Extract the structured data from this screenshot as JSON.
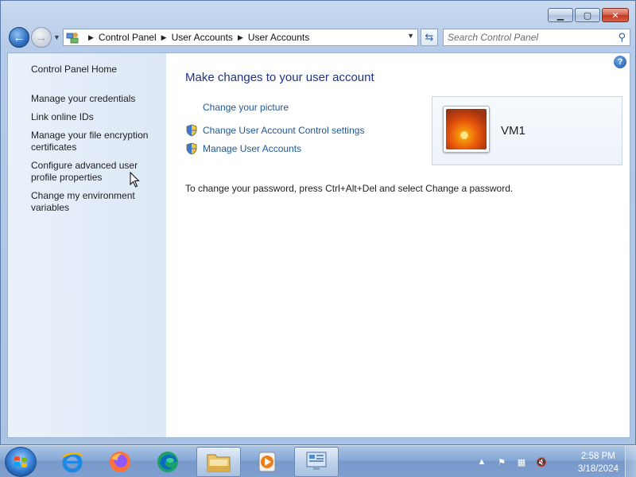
{
  "window": {
    "minimize_icon": "minimize-icon",
    "maximize_icon": "maximize-icon",
    "close_icon": "close-icon"
  },
  "navbar": {
    "breadcrumb": [
      "Control Panel",
      "User Accounts",
      "User Accounts"
    ],
    "search_placeholder": "Search Control Panel"
  },
  "sidebar": {
    "items": [
      "Control Panel Home",
      "Manage your credentials",
      "Link online IDs",
      "Manage your file encryption certificates",
      "Configure advanced user profile properties",
      "Change my environment variables"
    ]
  },
  "main": {
    "title": "Make changes to your user account",
    "tasks": [
      {
        "label": "Change your picture",
        "icon": ""
      },
      {
        "label": "Change User Account Control settings",
        "icon": "uac-shield-icon"
      },
      {
        "label": "Manage User Accounts",
        "icon": "uac-shield-icon"
      }
    ],
    "info": "To change your password, press Ctrl+Alt+Del and select Change a password."
  },
  "user": {
    "name": "VM1"
  },
  "taskbar": {
    "apps": [
      "internet-explorer-icon",
      "firefox-icon",
      "edge-icon",
      "windows-explorer-icon",
      "media-player-icon",
      "control-panel-icon"
    ],
    "time": "2:58 PM",
    "date": "3/18/2024"
  },
  "colors": {
    "link": "#1e5797",
    "title": "#1e3287",
    "sidebar_bg": "#e9f1fb"
  }
}
